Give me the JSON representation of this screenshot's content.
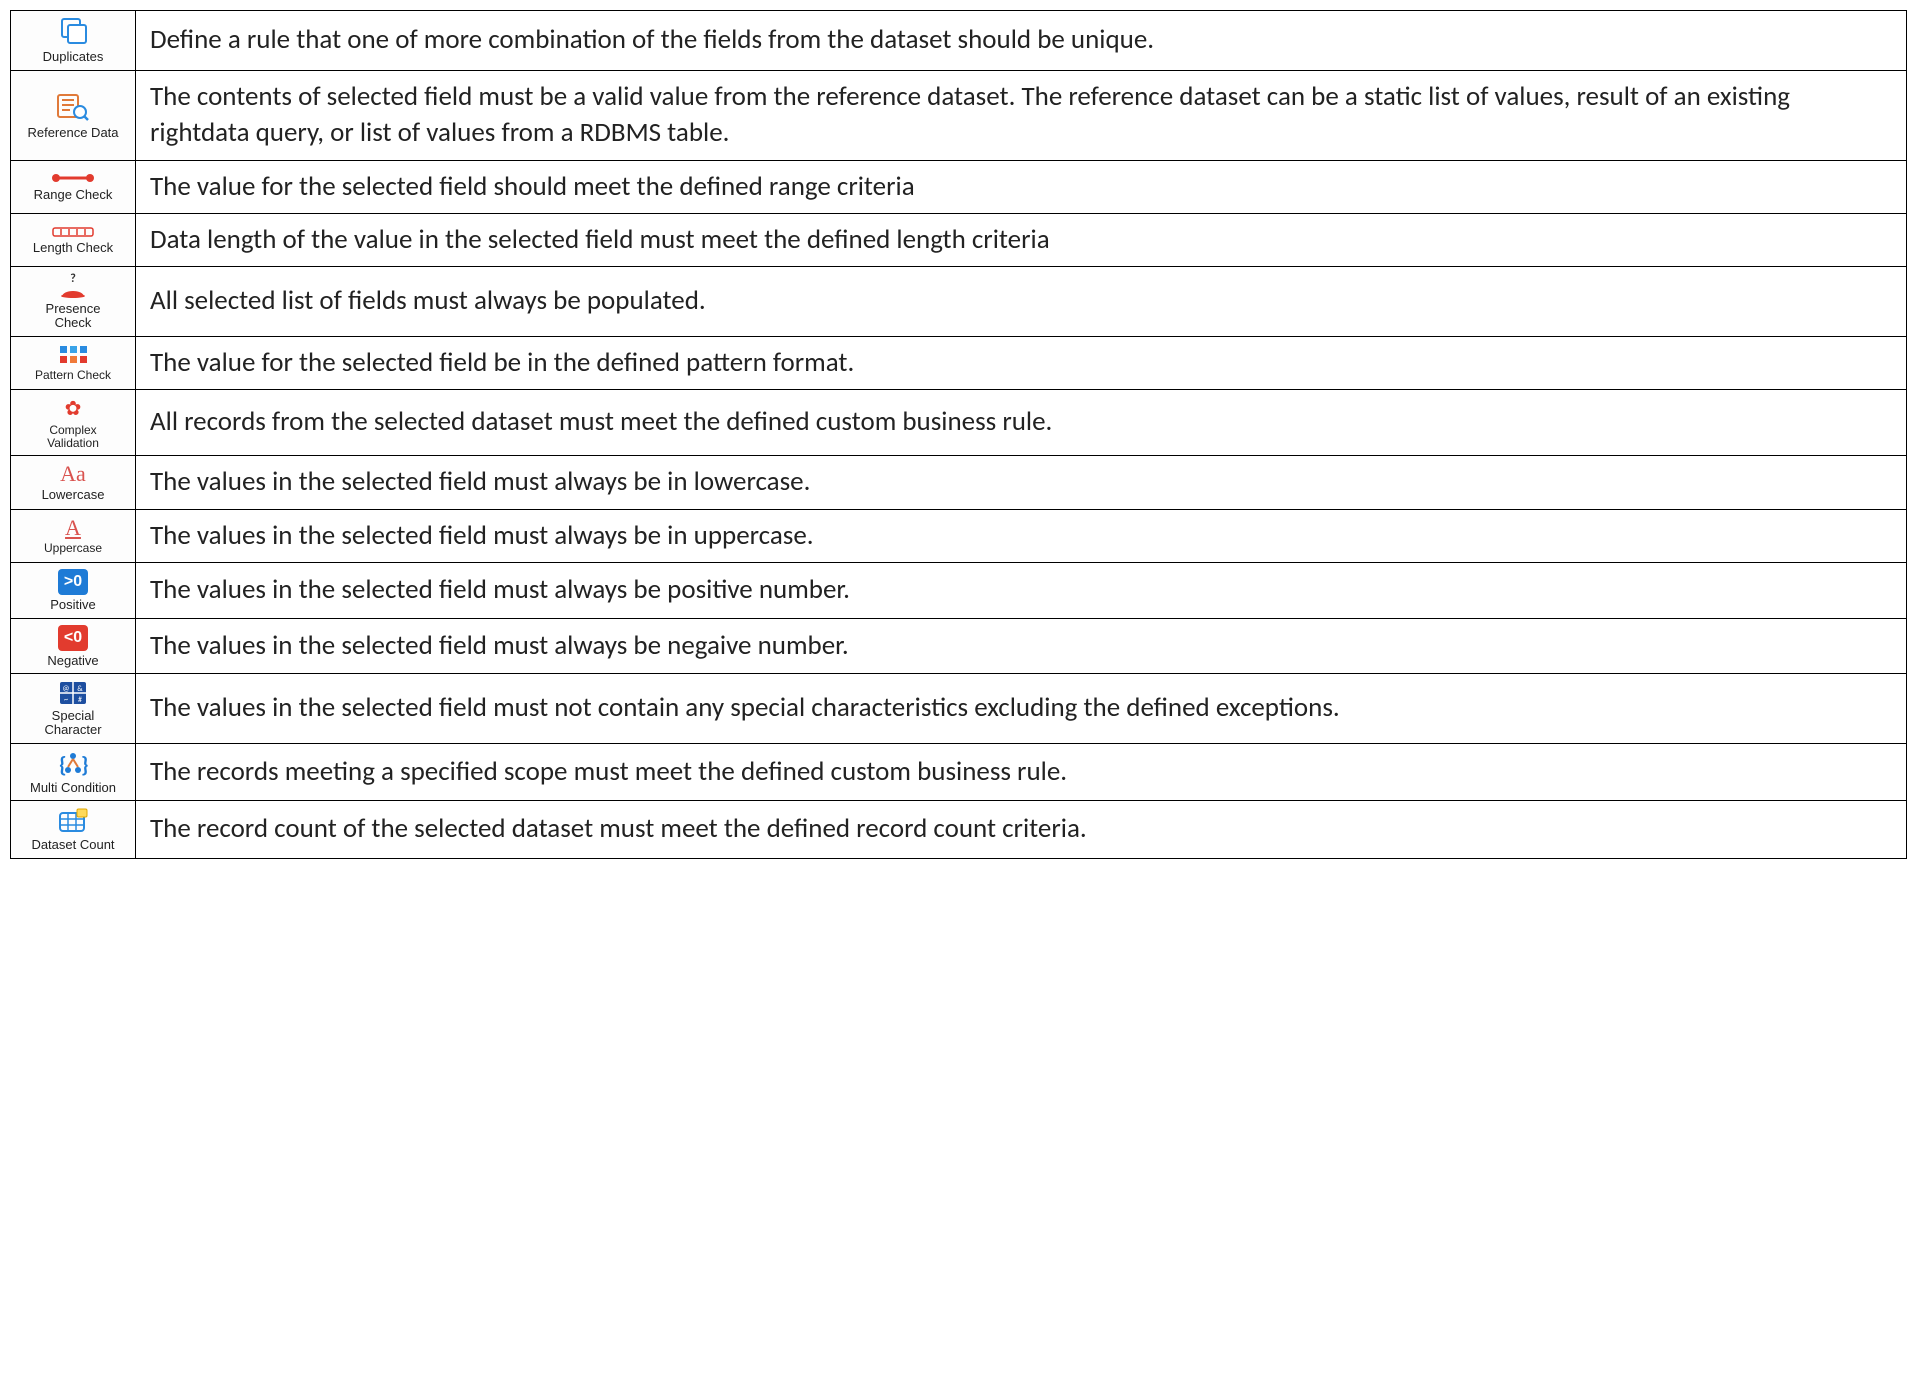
{
  "rows": [
    {
      "label": "Duplicates",
      "desc": "Define a rule that one of more combination of the fields from the dataset should be unique."
    },
    {
      "label": "Reference Data",
      "desc": "The contents of selected field must be a valid value from the reference dataset. The reference dataset can be a static list of values, result of an existing rightdata query, or list of values from a RDBMS table."
    },
    {
      "label": "Range Check",
      "desc": "The value for the selected field should meet the defined range criteria"
    },
    {
      "label": "Length Check",
      "desc": "Data length of the value in the selected field must meet the defined length criteria"
    },
    {
      "label": "Presence Check",
      "desc": "All selected list of fields must always be populated."
    },
    {
      "label": "Pattern Check",
      "desc": "The value for the selected field be in the defined pattern format."
    },
    {
      "label": "Complex Validation",
      "desc": "All records from the selected dataset must meet the defined custom business rule."
    },
    {
      "label": "Lowercase",
      "desc": "The values in the selected field must always be in lowercase."
    },
    {
      "label": "Uppercase",
      "desc": "The values in the selected field must always be in uppercase."
    },
    {
      "label": "Positive",
      "desc": "The values in the selected field must always be positive number."
    },
    {
      "label": "Negative",
      "desc": "The values in the selected field must always be negaive number."
    },
    {
      "label": "Special Character",
      "desc": "The values in the selected field must not contain any special characteristics excluding the defined exceptions."
    },
    {
      "label": "Multi Condition",
      "desc": "The records meeting a specified scope must meet the defined custom business rule."
    },
    {
      "label": "Dataset Count",
      "desc": "The record count of the selected dataset must meet the defined record count criteria."
    }
  ]
}
